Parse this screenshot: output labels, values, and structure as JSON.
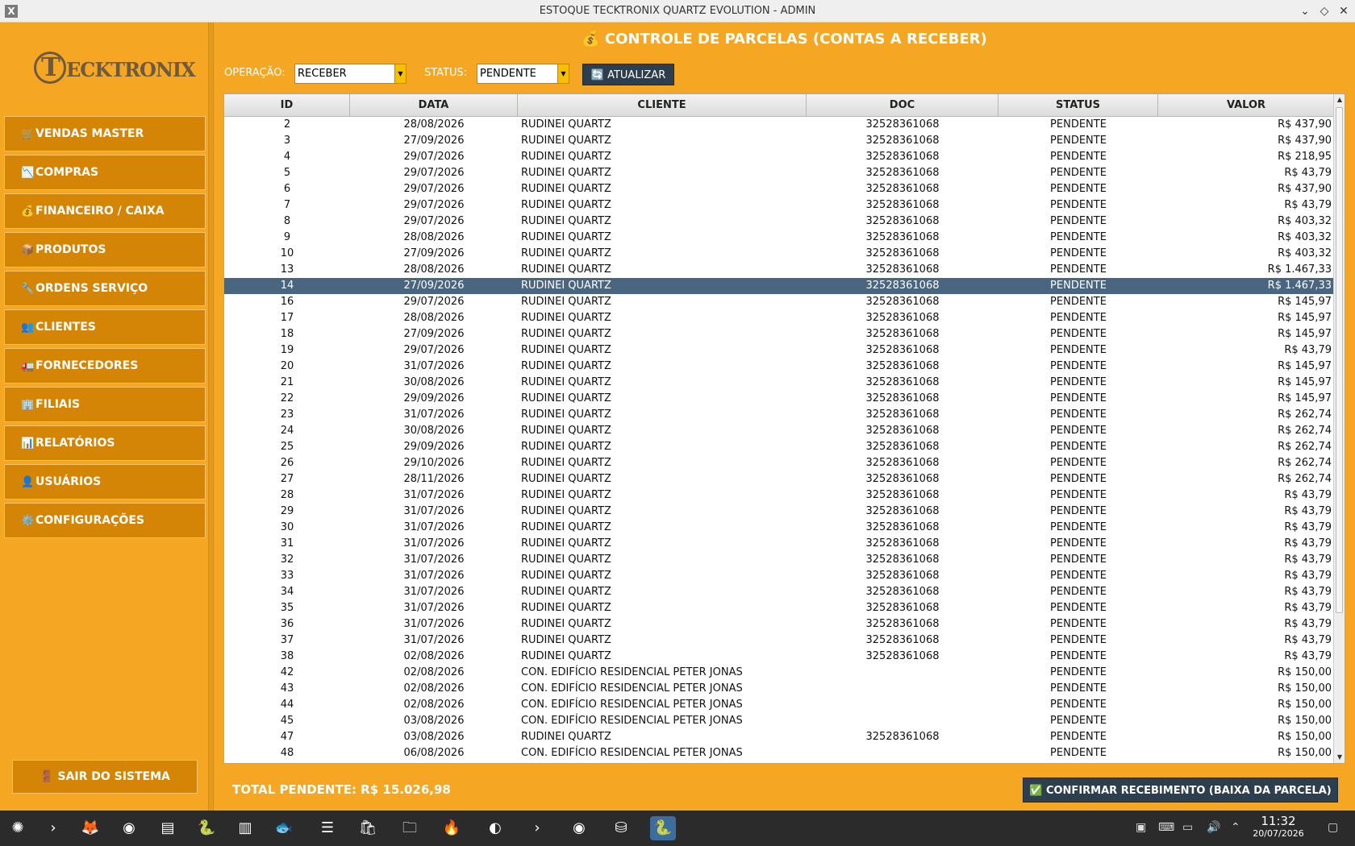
{
  "window": {
    "title": "ESTOQUE TECKTRONIX QUARTZ EVOLUTION - ADMIN",
    "app_icon": "X",
    "minimize": "⌄",
    "maximize": "◇",
    "close": "✕"
  },
  "logo": {
    "letter": "T",
    "rest": "ECKTRONIX"
  },
  "sidebar": {
    "items": [
      {
        "icon": "🛒",
        "label": "VENDAS MASTER"
      },
      {
        "icon": "📉",
        "label": "COMPRAS"
      },
      {
        "icon": "💰",
        "label": "FINANCEIRO / CAIXA"
      },
      {
        "icon": "📦",
        "label": "PRODUTOS"
      },
      {
        "icon": "🔧",
        "label": "ORDENS SERVIÇO"
      },
      {
        "icon": "👥",
        "label": "CLIENTES"
      },
      {
        "icon": "🚛",
        "label": "FORNECEDORES"
      },
      {
        "icon": "🏢",
        "label": "FILIAIS"
      },
      {
        "icon": "📊",
        "label": "RELATÓRIOS"
      },
      {
        "icon": "👤",
        "label": "USUÁRIOS"
      },
      {
        "icon": "⚙️",
        "label": "CONFIGURAÇÕES"
      }
    ],
    "exit": {
      "icon": "🚪",
      "label": "SAIR DO SISTEMA"
    }
  },
  "main": {
    "title": "💰 CONTROLE DE PARCELAS (CONTAS A RECEBER)",
    "operation_label": "OPERAÇÃO:",
    "operation_value": "RECEBER",
    "status_label": "STATUS:",
    "status_value": "PENDENTE",
    "refresh_label": "🔄 ATUALIZAR"
  },
  "table": {
    "columns": [
      "ID",
      "DATA",
      "CLIENTE",
      "DOC",
      "STATUS",
      "VALOR"
    ],
    "selected_id": "14",
    "rows": [
      [
        "2",
        "28/08/2026",
        "RUDINEI QUARTZ",
        "32528361068",
        "PENDENTE",
        "R$ 437,90"
      ],
      [
        "3",
        "27/09/2026",
        "RUDINEI QUARTZ",
        "32528361068",
        "PENDENTE",
        "R$ 437,90"
      ],
      [
        "4",
        "29/07/2026",
        "RUDINEI QUARTZ",
        "32528361068",
        "PENDENTE",
        "R$ 218,95"
      ],
      [
        "5",
        "29/07/2026",
        "RUDINEI QUARTZ",
        "32528361068",
        "PENDENTE",
        "R$ 43,79"
      ],
      [
        "6",
        "29/07/2026",
        "RUDINEI QUARTZ",
        "32528361068",
        "PENDENTE",
        "R$ 437,90"
      ],
      [
        "7",
        "29/07/2026",
        "RUDINEI QUARTZ",
        "32528361068",
        "PENDENTE",
        "R$ 43,79"
      ],
      [
        "8",
        "29/07/2026",
        "RUDINEI QUARTZ",
        "32528361068",
        "PENDENTE",
        "R$ 403,32"
      ],
      [
        "9",
        "28/08/2026",
        "RUDINEI QUARTZ",
        "32528361068",
        "PENDENTE",
        "R$ 403,32"
      ],
      [
        "10",
        "27/09/2026",
        "RUDINEI QUARTZ",
        "32528361068",
        "PENDENTE",
        "R$ 403,32"
      ],
      [
        "13",
        "28/08/2026",
        "RUDINEI QUARTZ",
        "32528361068",
        "PENDENTE",
        "R$ 1.467,33"
      ],
      [
        "14",
        "27/09/2026",
        "RUDINEI QUARTZ",
        "32528361068",
        "PENDENTE",
        "R$ 1.467,33"
      ],
      [
        "16",
        "29/07/2026",
        "RUDINEI QUARTZ",
        "32528361068",
        "PENDENTE",
        "R$ 145,97"
      ],
      [
        "17",
        "28/08/2026",
        "RUDINEI QUARTZ",
        "32528361068",
        "PENDENTE",
        "R$ 145,97"
      ],
      [
        "18",
        "27/09/2026",
        "RUDINEI QUARTZ",
        "32528361068",
        "PENDENTE",
        "R$ 145,97"
      ],
      [
        "19",
        "29/07/2026",
        "RUDINEI QUARTZ",
        "32528361068",
        "PENDENTE",
        "R$ 43,79"
      ],
      [
        "20",
        "31/07/2026",
        "RUDINEI QUARTZ",
        "32528361068",
        "PENDENTE",
        "R$ 145,97"
      ],
      [
        "21",
        "30/08/2026",
        "RUDINEI QUARTZ",
        "32528361068",
        "PENDENTE",
        "R$ 145,97"
      ],
      [
        "22",
        "29/09/2026",
        "RUDINEI QUARTZ",
        "32528361068",
        "PENDENTE",
        "R$ 145,97"
      ],
      [
        "23",
        "31/07/2026",
        "RUDINEI QUARTZ",
        "32528361068",
        "PENDENTE",
        "R$ 262,74"
      ],
      [
        "24",
        "30/08/2026",
        "RUDINEI QUARTZ",
        "32528361068",
        "PENDENTE",
        "R$ 262,74"
      ],
      [
        "25",
        "29/09/2026",
        "RUDINEI QUARTZ",
        "32528361068",
        "PENDENTE",
        "R$ 262,74"
      ],
      [
        "26",
        "29/10/2026",
        "RUDINEI QUARTZ",
        "32528361068",
        "PENDENTE",
        "R$ 262,74"
      ],
      [
        "27",
        "28/11/2026",
        "RUDINEI QUARTZ",
        "32528361068",
        "PENDENTE",
        "R$ 262,74"
      ],
      [
        "28",
        "31/07/2026",
        "RUDINEI QUARTZ",
        "32528361068",
        "PENDENTE",
        "R$ 43,79"
      ],
      [
        "29",
        "31/07/2026",
        "RUDINEI QUARTZ",
        "32528361068",
        "PENDENTE",
        "R$ 43,79"
      ],
      [
        "30",
        "31/07/2026",
        "RUDINEI QUARTZ",
        "32528361068",
        "PENDENTE",
        "R$ 43,79"
      ],
      [
        "31",
        "31/07/2026",
        "RUDINEI QUARTZ",
        "32528361068",
        "PENDENTE",
        "R$ 43,79"
      ],
      [
        "32",
        "31/07/2026",
        "RUDINEI QUARTZ",
        "32528361068",
        "PENDENTE",
        "R$ 43,79"
      ],
      [
        "33",
        "31/07/2026",
        "RUDINEI QUARTZ",
        "32528361068",
        "PENDENTE",
        "R$ 43,79"
      ],
      [
        "34",
        "31/07/2026",
        "RUDINEI QUARTZ",
        "32528361068",
        "PENDENTE",
        "R$ 43,79"
      ],
      [
        "35",
        "31/07/2026",
        "RUDINEI QUARTZ",
        "32528361068",
        "PENDENTE",
        "R$ 43,79"
      ],
      [
        "36",
        "31/07/2026",
        "RUDINEI QUARTZ",
        "32528361068",
        "PENDENTE",
        "R$ 43,79"
      ],
      [
        "37",
        "31/07/2026",
        "RUDINEI QUARTZ",
        "32528361068",
        "PENDENTE",
        "R$ 43,79"
      ],
      [
        "38",
        "02/08/2026",
        "RUDINEI QUARTZ",
        "32528361068",
        "PENDENTE",
        "R$ 43,79"
      ],
      [
        "42",
        "02/08/2026",
        "CON. EDIFÍCIO RESIDENCIAL PETER JONAS",
        "",
        "PENDENTE",
        "R$ 150,00"
      ],
      [
        "43",
        "02/08/2026",
        "CON. EDIFÍCIO RESIDENCIAL PETER JONAS",
        "",
        "PENDENTE",
        "R$ 150,00"
      ],
      [
        "44",
        "02/08/2026",
        "CON. EDIFÍCIO RESIDENCIAL PETER JONAS",
        "",
        "PENDENTE",
        "R$ 150,00"
      ],
      [
        "45",
        "03/08/2026",
        "CON. EDIFÍCIO RESIDENCIAL PETER JONAS",
        "",
        "PENDENTE",
        "R$ 150,00"
      ],
      [
        "47",
        "03/08/2026",
        "RUDINEI QUARTZ",
        "32528361068",
        "PENDENTE",
        "R$ 150,00"
      ],
      [
        "48",
        "06/08/2026",
        "CON. EDIFÍCIO RESIDENCIAL PETER JONAS",
        "",
        "PENDENTE",
        "R$ 150,00"
      ]
    ]
  },
  "footer": {
    "total": "TOTAL PENDENTE: R$ 15.026,98",
    "confirm_label": "✅ CONFIRMAR RECEBIMENTO (BAIXA DA PARCELA)"
  },
  "taskbar": {
    "time": "11:32",
    "date": "20/07/2026"
  },
  "colors": {
    "background": "#f5a623",
    "menu_button": "#d48506",
    "dark_button": "#2d3e4f",
    "selected_row": "#4a6580"
  }
}
